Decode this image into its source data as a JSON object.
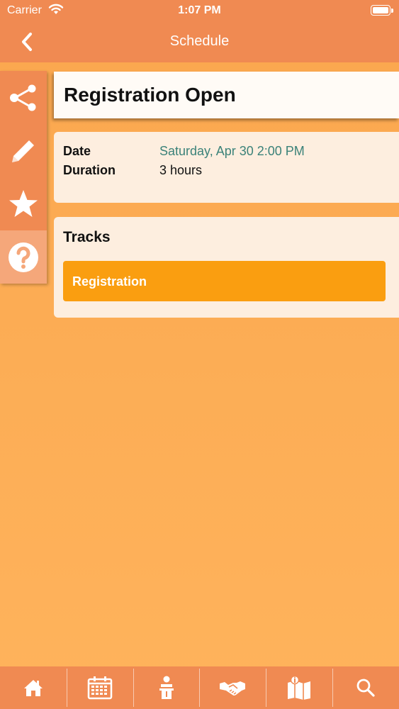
{
  "status_bar": {
    "carrier": "Carrier",
    "time": "1:07 PM"
  },
  "nav": {
    "title": "Schedule"
  },
  "side_actions": [
    {
      "icon": "share-icon"
    },
    {
      "icon": "pencil-icon"
    },
    {
      "icon": "star-icon"
    },
    {
      "icon": "question-icon"
    }
  ],
  "event": {
    "title": "Registration Open",
    "date_label": "Date",
    "date_value": "Saturday, Apr 30 2:00 PM",
    "duration_label": "Duration",
    "duration_value": "3 hours",
    "tracks_heading": "Tracks",
    "tracks": [
      "Registration"
    ]
  },
  "tab_bar": {
    "tabs": [
      "home-icon",
      "calendar-icon",
      "speaker-icon",
      "handshake-icon",
      "map-icon",
      "search-icon"
    ]
  },
  "colors": {
    "header": "#f08a52",
    "background": "#fcad55",
    "track": "#fa9e10",
    "date_value": "#3b8279"
  }
}
